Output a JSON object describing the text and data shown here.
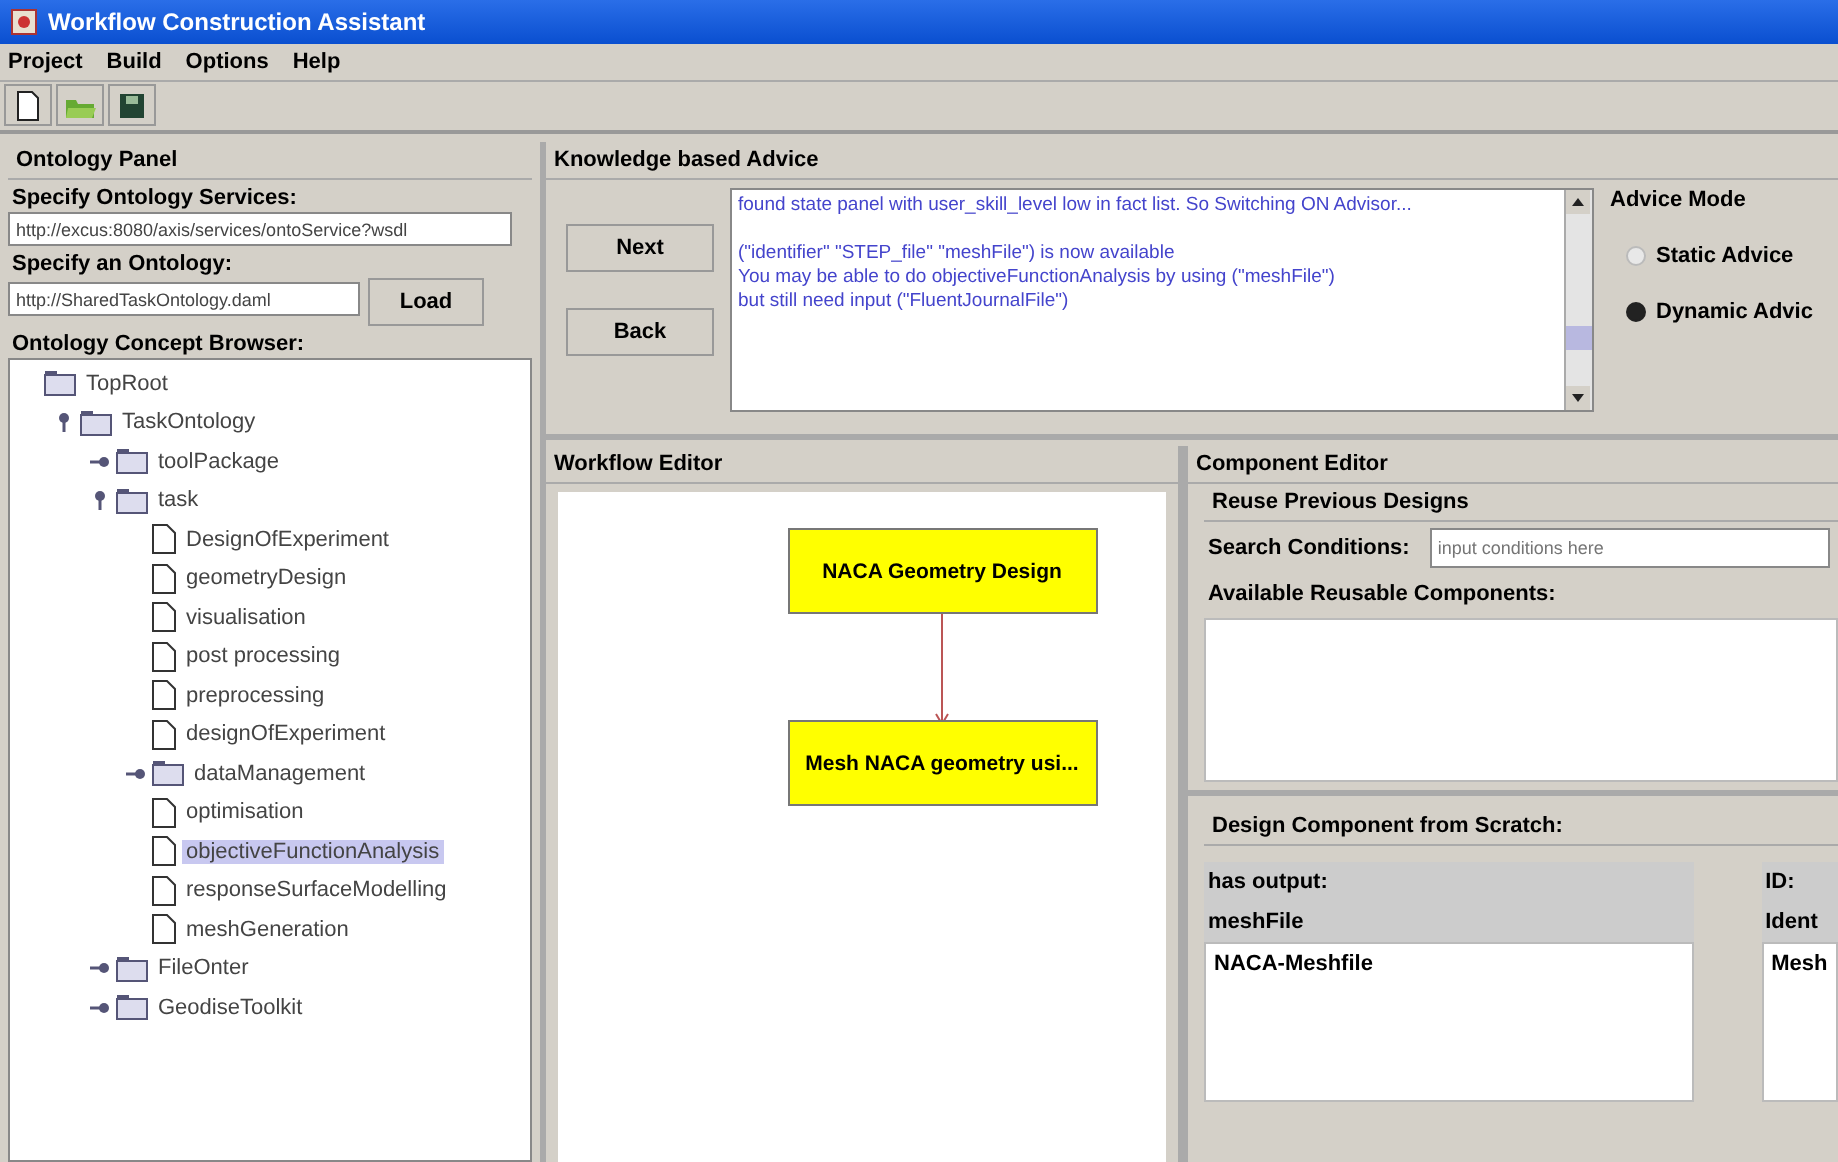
{
  "window": {
    "title": "Workflow Construction Assistant"
  },
  "menu": [
    "Project",
    "Build",
    "Options",
    "Help"
  ],
  "toolbar": [
    {
      "kind": "new"
    },
    {
      "kind": "open"
    },
    {
      "kind": "save"
    }
  ],
  "ontology_panel": {
    "title": "Ontology Panel",
    "services_label": "Specify Ontology Services:",
    "services_value": "http://excus:8080/axis/services/ontoService?wsdl",
    "ontology_label": "Specify an Ontology:",
    "ontology_value": "http://SharedTaskOntology.daml",
    "load_button": "Load",
    "browser_label": "Ontology Concept Browser:",
    "tree": [
      {
        "label": "TopRoot",
        "kind": "folder",
        "selected": false,
        "children": [
          {
            "label": "TaskOntology",
            "kind": "folder",
            "expanded": true,
            "selected": false,
            "children": [
              {
                "label": "toolPackage",
                "kind": "folder",
                "expanded": false,
                "selected": false
              },
              {
                "label": "task",
                "kind": "folder",
                "expanded": true,
                "selected": false,
                "children": [
                  {
                    "label": "DesignOfExperiment",
                    "kind": "file",
                    "selected": false
                  },
                  {
                    "label": "geometryDesign",
                    "kind": "file",
                    "selected": false
                  },
                  {
                    "label": "visualisation",
                    "kind": "file",
                    "selected": false
                  },
                  {
                    "label": "post processing",
                    "kind": "file",
                    "selected": false
                  },
                  {
                    "label": "preprocessing",
                    "kind": "file",
                    "selected": false
                  },
                  {
                    "label": "designOfExperiment",
                    "kind": "file",
                    "selected": false
                  },
                  {
                    "label": "dataManagement",
                    "kind": "folder",
                    "expanded": false,
                    "selected": false
                  },
                  {
                    "label": "optimisation",
                    "kind": "file",
                    "selected": false
                  },
                  {
                    "label": "objectiveFunctionAnalysis",
                    "kind": "file",
                    "selected": true
                  },
                  {
                    "label": "responseSurfaceModelling",
                    "kind": "file",
                    "selected": false
                  },
                  {
                    "label": "meshGeneration",
                    "kind": "file",
                    "selected": false
                  }
                ]
              },
              {
                "label": "FileOnter",
                "kind": "folder",
                "expanded": false,
                "selected": false
              },
              {
                "label": "GeodiseToolkit",
                "kind": "folder",
                "expanded": false,
                "selected": false
              }
            ]
          }
        ]
      }
    ]
  },
  "advice": {
    "title": "Knowledge based Advice",
    "buttons": [
      "Next",
      "Back"
    ],
    "lines": [
      "found state panel with user_skill_level low in fact list. So Switching ON Advisor...",
      "(\"identifier\" \"STEP_file\" \"meshFile\") is now available",
      "You may be able to do objectiveFunctionAnalysis by using (\"meshFile\")",
      "but still need input (\"FluentJournalFile\")"
    ],
    "mode_title": "Advice Mode",
    "modes": [
      {
        "label": "Static Advice",
        "selected": false
      },
      {
        "label": "Dynamic Advic",
        "selected": true
      }
    ]
  },
  "workflow_editor": {
    "title": "Workflow Editor",
    "nodes": [
      {
        "label": "NACA Geometry Design"
      },
      {
        "label": "Mesh NACA geometry usi..."
      }
    ]
  },
  "component_editor": {
    "title": "Component Editor",
    "reuse_title": "Reuse Previous Designs",
    "search_label": "Search Conditions:",
    "search_placeholder": "input conditions here",
    "available_label": "Available Reusable Components:",
    "scratch_title": "Design Component from Scratch:",
    "output_label": "has output:",
    "output_name": "meshFile",
    "output_value": "NACA-Meshfile",
    "id_label": "ID:",
    "id_name": "Ident",
    "id_value": "Mesh"
  }
}
